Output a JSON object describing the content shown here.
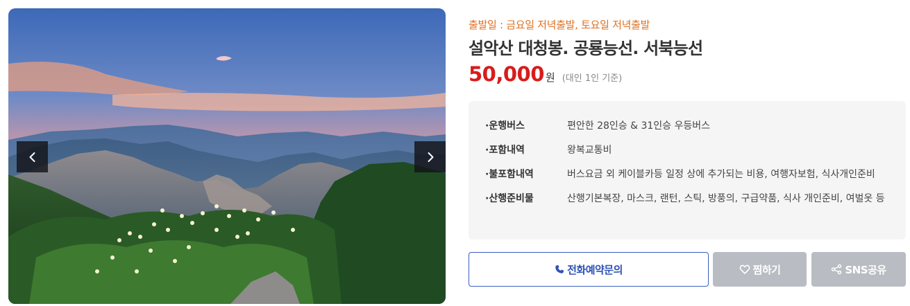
{
  "gallery": {
    "prev_label": "‹",
    "next_label": "›",
    "image_description_icon": "mountain-photo"
  },
  "product": {
    "departure": "출발일 : 금요일 저녁출발, 토요일 저녁출발",
    "title": "설악산 대청봉. 공룡능선. 서북능선",
    "price": "50,000",
    "currency": "원",
    "price_basis": "(대인 1인 기준)"
  },
  "details": [
    {
      "label": "·운행버스",
      "value": "편안한 28인승 & 31인승 우등버스"
    },
    {
      "label": "·포함내역",
      "value": "왕복교통비"
    },
    {
      "label": "·불포함내역",
      "value": "버스요금 외 케이블카등 일정 상에 추가되는 비용, 여행자보험, 식사개인준비"
    },
    {
      "label": "·산행준비물",
      "value": "산행기본복장, 마스크, 랜턴, 스틱, 방풍의, 구급약품, 식사 개인준비, 여벌옷 등"
    }
  ],
  "actions": {
    "call_label": "전화예약문의",
    "wish_label": "찜하기",
    "share_label": "SNS공유"
  },
  "colors": {
    "departure": "#e06f1e",
    "price": "#d81c1c",
    "call_border": "#3a5fbf",
    "gray_button": "#b9bcc2"
  },
  "icons": {
    "call": "phone-icon",
    "wish": "heart-icon",
    "share": "share-icon",
    "prev": "chevron-left-icon",
    "next": "chevron-right-icon"
  }
}
